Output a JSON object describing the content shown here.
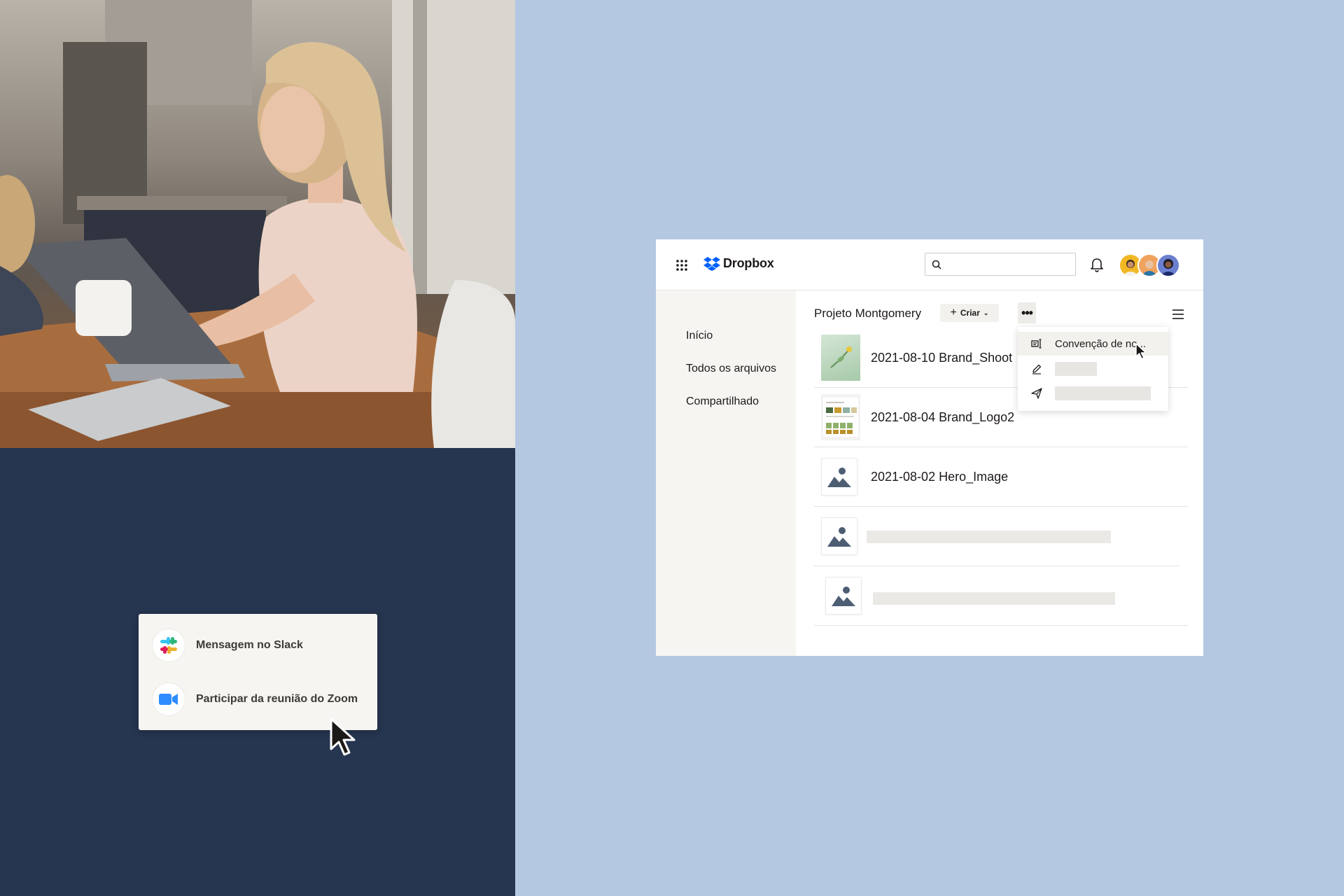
{
  "integrations": {
    "slack_label": "Mensagem no Slack",
    "zoom_label": "Participar da reunião do Zoom"
  },
  "app": {
    "logo_text": "Dropbox",
    "search_placeholder": ""
  },
  "sidebar": {
    "items": [
      {
        "label": "Início"
      },
      {
        "label": "Todos os arquivos"
      },
      {
        "label": "Compartilhado"
      }
    ]
  },
  "toolbar": {
    "breadcrumb": "Projeto Montgomery",
    "create_label": "Criar"
  },
  "files": [
    {
      "name": "2021-08-10 Brand_Shoot",
      "thumb": "photo"
    },
    {
      "name": "2021-08-04 Brand_Logo2",
      "thumb": "document"
    },
    {
      "name": "2021-08-02 Hero_Image",
      "thumb": "image-placeholder-icon"
    },
    {
      "name": "",
      "thumb": "image-placeholder-icon"
    },
    {
      "name": "",
      "thumb": "image-placeholder-icon"
    }
  ],
  "context_menu": {
    "items": [
      {
        "label": "Convenção de no...",
        "icon": "naming-convention-icon"
      },
      {
        "label": "",
        "icon": "pencil-icon"
      },
      {
        "label": "",
        "icon": "send-icon"
      }
    ]
  },
  "colors": {
    "page_background": "#b4c8e2",
    "navy_panel": "#263550",
    "dropbox_blue": "#0061fe",
    "sidebar_background": "#f7f5f2"
  }
}
